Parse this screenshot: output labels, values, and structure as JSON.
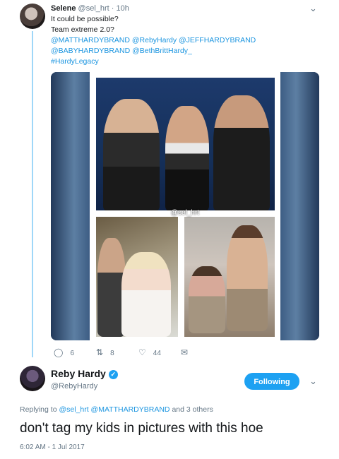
{
  "tweet1": {
    "name": "Selene",
    "handle": "@sel_hrt",
    "time": "10h",
    "text_lines": [
      "It could be possible?",
      "Team extreme 2.0?"
    ],
    "mentions_line1": "@MATTHARDYBRAND @RebyHardy  @JEFFHARDYBRAND",
    "mentions_line2": "@BABYHARDYBRAND @BethBrittHardy_",
    "hashtag": "#HardyLegacy",
    "media_watermark": "@sel_hrt",
    "replies": "6",
    "retweets": "8",
    "likes": "44"
  },
  "tweet2": {
    "name": "Reby Hardy",
    "handle": "@RebyHardy",
    "follow_label": "Following",
    "replying_prefix": "Replying to",
    "replying_users": "@sel_hrt @MATTHARDYBRAND",
    "replying_suffix": "and 3 others",
    "text": "don't tag my kids in pictures with this hoe",
    "timestamp": "6:02 AM - 1 Jul 2017"
  },
  "colors": {
    "accent": "#1da1f2",
    "link": "#1b95e0",
    "meta": "#657786",
    "thread": "#9fd7f8"
  },
  "icons": {
    "reply": "reply-icon",
    "retweet": "retweet-icon",
    "like": "heart-icon",
    "dm": "envelope-icon",
    "verified": "verified-badge-icon",
    "more": "chevron-down-icon"
  }
}
